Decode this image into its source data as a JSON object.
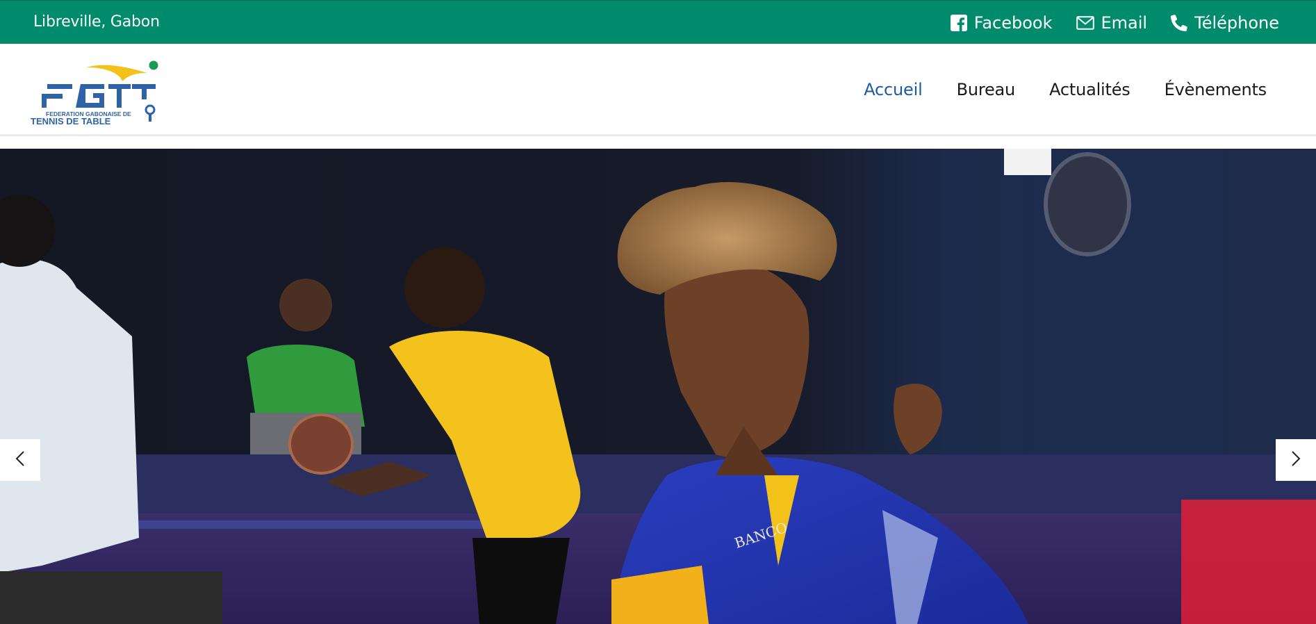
{
  "topbar": {
    "location": "Libreville, Gabon",
    "links": [
      {
        "label": "Facebook",
        "icon": "facebook-icon"
      },
      {
        "label": "Email",
        "icon": "envelope-icon"
      },
      {
        "label": "Téléphone",
        "icon": "phone-icon"
      }
    ]
  },
  "header": {
    "logo": {
      "acronym": "FGTT",
      "line1": "FEDERATION GABONAISE DE",
      "line2": "TENNIS DE TABLE"
    },
    "nav": [
      {
        "label": "Accueil",
        "active": true
      },
      {
        "label": "Bureau",
        "active": false
      },
      {
        "label": "Actualités",
        "active": false
      },
      {
        "label": "Évènements",
        "active": false
      }
    ]
  },
  "hero": {
    "jersey_text": "BANCO",
    "prev_icon": "chevron-left-icon",
    "next_icon": "chevron-right-icon"
  },
  "colors": {
    "topbar": "#008c6c",
    "nav_active": "#1d5aa6",
    "logo_blue": "#2f63a8",
    "logo_yellow": "#f2c21b",
    "logo_green": "#1a9a52"
  }
}
